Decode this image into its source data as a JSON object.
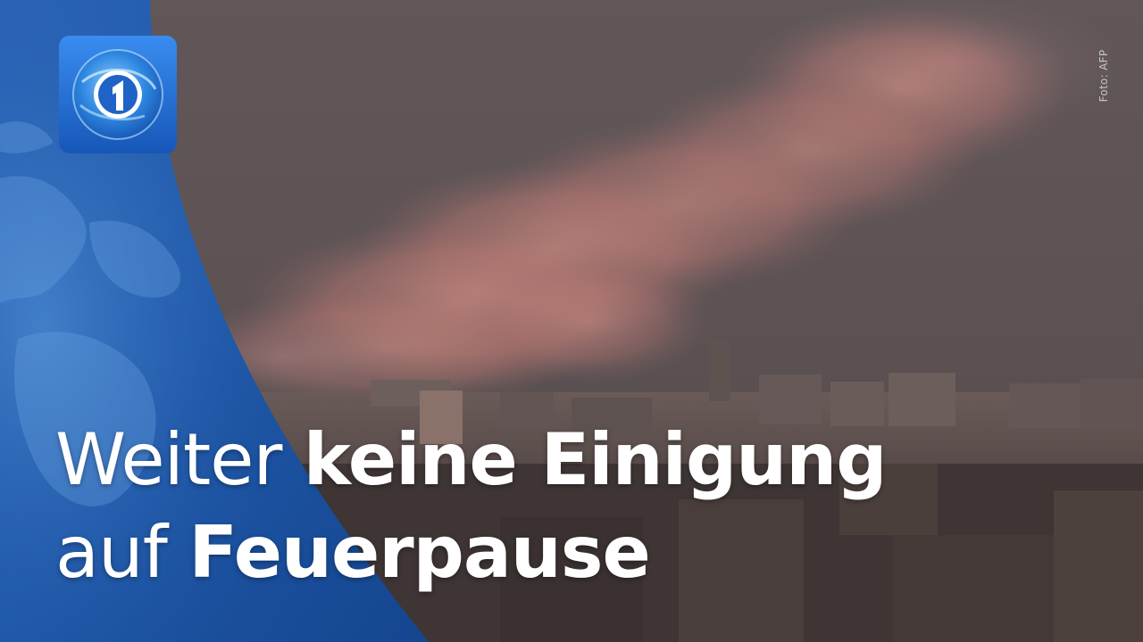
{
  "credit": "Foto: AFP",
  "headline": {
    "line1_thin": "Weiter",
    "line1_bold": "keine Einigung",
    "line2_thin": "auf",
    "line2_bold": "Feuerpause"
  },
  "colors": {
    "panel_blue": "#1c4f9c",
    "logo_blue": "#1e6fd0",
    "sky": "#5e5456",
    "smoke": "#c47d76"
  },
  "icons": {
    "logo": "das-erste-logo-icon"
  }
}
